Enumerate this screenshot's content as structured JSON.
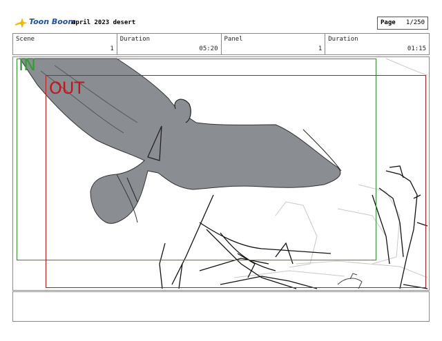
{
  "header": {
    "logo_text": "Toon Boom",
    "project_title": "april 2023 desert",
    "page_label": "Page",
    "page_value": "1/250"
  },
  "info": {
    "scene_label": "Scene",
    "scene_value": "1",
    "scene_duration_label": "Duration",
    "scene_duration_value": "05:20",
    "panel_label": "Panel",
    "panel_value": "1",
    "panel_duration_label": "Duration",
    "panel_duration_value": "01:15"
  },
  "frames": {
    "in_label": "IN",
    "out_label": "OUT"
  },
  "colors": {
    "in_frame": "#2f8f2f",
    "out_frame": "#c01818",
    "bird_fill": "#8a8d92",
    "logo_star": "#f2b705"
  }
}
